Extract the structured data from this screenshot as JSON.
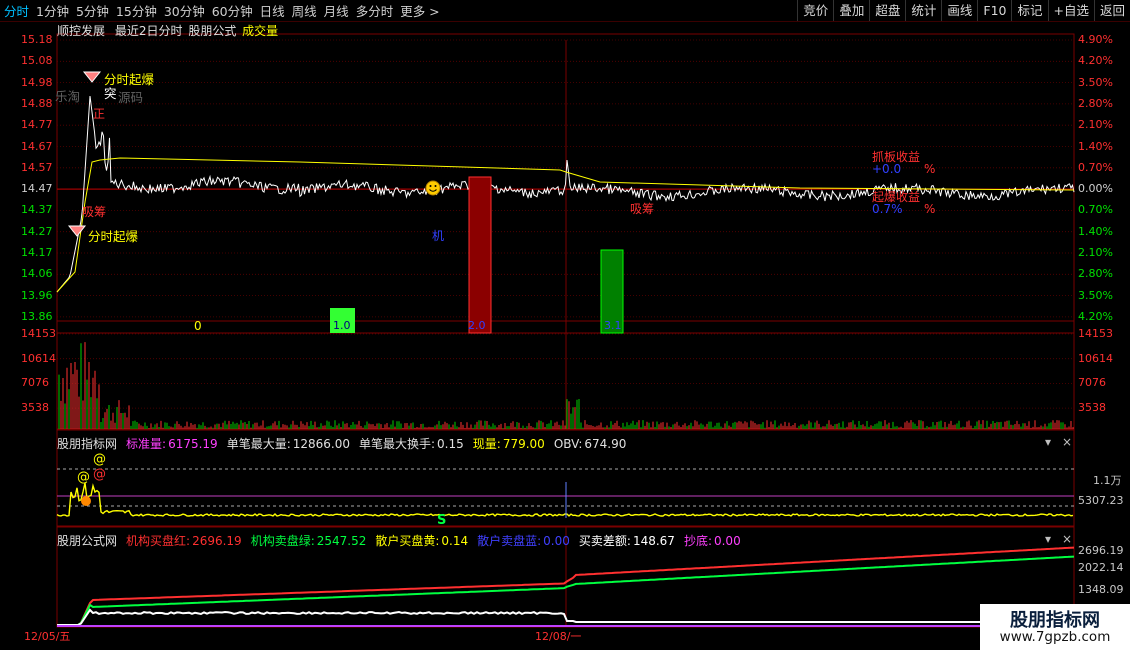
{
  "toolbar": {
    "periods": [
      "分时",
      "1分钟",
      "5分钟",
      "15分钟",
      "30分钟",
      "60分钟",
      "日线",
      "周线",
      "月线",
      "多分时",
      "更多 >"
    ],
    "buttons": [
      "竞价",
      "叠加",
      "超盘",
      "统计",
      "画线",
      "F10",
      "标记",
      "+自选",
      "返回"
    ]
  },
  "header": {
    "title": "顺控发展",
    "subtitle": "最近2日分时",
    "formula": "股朋公式",
    "volume_label": "成交量"
  },
  "price_panel": {
    "left_ticks": [
      "15.18",
      "15.08",
      "14.98",
      "14.88",
      "14.77",
      "14.67",
      "14.57",
      "14.47",
      "14.37",
      "14.27",
      "14.17",
      "14.06",
      "13.96",
      "13.86"
    ],
    "right_ticks": [
      "4.90%",
      "4.20%",
      "3.50%",
      "2.80%",
      "2.10%",
      "1.40%",
      "0.70%",
      "0.00%",
      "0.70%",
      "1.40%",
      "2.10%",
      "2.80%",
      "3.50%",
      "4.20%"
    ],
    "annotations": {
      "fenshi_qibao_top": "分时起爆",
      "tu": "突",
      "lequ": "乐淘",
      "yuanma": "源码",
      "zheng": "正",
      "xichou_left": "吸筹",
      "fenshi_qibao_bottom": "分时起爆",
      "zero": "0",
      "bar_green_label": "1.0",
      "bar_red_label": "2.0",
      "bar_dark_green_label": "3.1",
      "ji": "机",
      "xichou_right": "吸筹",
      "zhuaban": "抓板收益",
      "zhuaban_val": "+0.0",
      "qibao": "起爆收益",
      "qibao_val": "0.7%",
      "pct": "%"
    },
    "smile_icon": "smiley-icon"
  },
  "volume_panel": {
    "left_ticks": [
      "14153",
      "10614",
      "7076",
      "3538"
    ],
    "right_ticks": [
      "14153",
      "10614",
      "7076",
      "3538"
    ]
  },
  "indicator1": {
    "name": "股朋指标网",
    "items": [
      {
        "label": "标准量:",
        "value": "6175.19",
        "color": "#ff40ff"
      },
      {
        "label": "单笔最大量:",
        "value": "12866.00",
        "color": "#e0e0e0"
      },
      {
        "label": "单笔最大换手:",
        "value": "0.15",
        "color": "#e0e0e0"
      },
      {
        "label": "现量:",
        "value": "779.00",
        "color": "#ffff00"
      },
      {
        "label": "OBV:",
        "value": "674.90",
        "color": "#e0e0e0"
      }
    ],
    "right_ticks": [
      "1.1万",
      "5307.23"
    ],
    "markers": {
      "at1": "@",
      "at2": "@",
      "at3": "@",
      "s": "S"
    }
  },
  "indicator2": {
    "name": "股朋公式网",
    "items": [
      {
        "label": "机构买盘红:",
        "value": "2696.19",
        "color": "#ff3030"
      },
      {
        "label": "机构卖盘绿:",
        "value": "2547.52",
        "color": "#00ff40"
      },
      {
        "label": "散户买盘黄:",
        "value": "0.14",
        "color": "#ffff00"
      },
      {
        "label": "散户卖盘蓝:",
        "value": "0.00",
        "color": "#4040ff"
      },
      {
        "label": "买卖差额:",
        "value": "148.67",
        "color": "#ffffff"
      },
      {
        "label": "抄底:",
        "value": "0.00",
        "color": "#ff40ff"
      }
    ],
    "right_ticks": [
      "2696.19",
      "2022.14",
      "1348.09"
    ]
  },
  "date_axis": {
    "left": "12/05/五",
    "mid": "12/08/一"
  },
  "watermark": {
    "title": "股朋指标网",
    "url": "www.7gpzb.com"
  },
  "panel_controls": {
    "collapse": "▾",
    "close": "×"
  },
  "colors": {
    "red": "#ff3030",
    "green": "#00ff40",
    "yellow": "#ffff00",
    "grid": "#7a0000",
    "up": "#ff3030",
    "down": "#00e000"
  }
}
